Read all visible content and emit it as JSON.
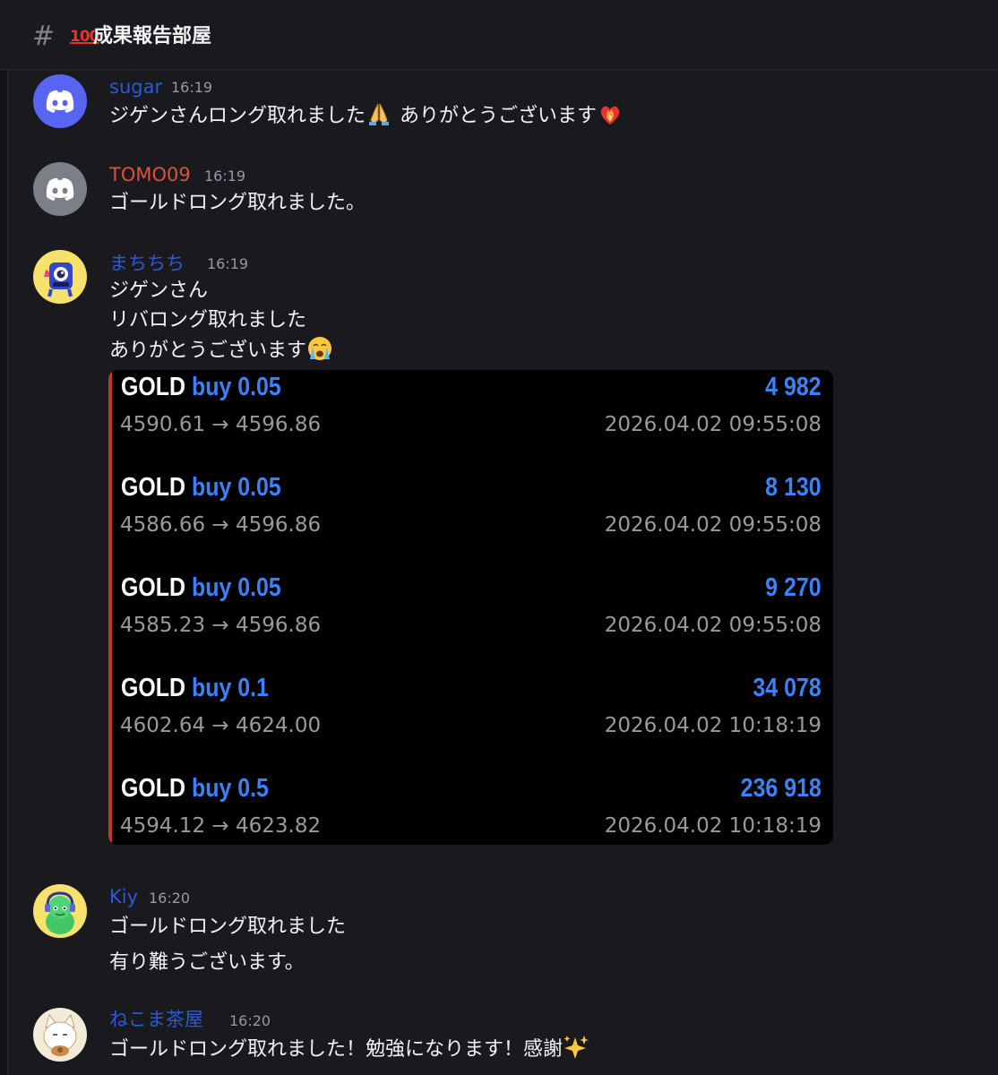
{
  "channel": {
    "hash": "#",
    "emoji": "100",
    "title": "成果報告部屋"
  },
  "messages": [
    {
      "username": "sugar",
      "username_color": "#2a5bd7",
      "time": "16:19",
      "avatar": "discord-logo-blurple",
      "lines": [
        "ジゲンさんロング取れました",
        "ありがとうございます"
      ],
      "emojis": [
        "folded-hands",
        "fire-heart"
      ]
    },
    {
      "username": "TOMO09",
      "username_color": "#e0503e",
      "time": "16:19",
      "avatar": "discord-logo-grey",
      "lines": [
        "ゴールドロング取れました。"
      ]
    },
    {
      "username": "まちちち",
      "username_color": "#2a5bd7",
      "time": "16:19",
      "avatar": "blue-monster-on-yellow",
      "lines": [
        "ジゲンさん",
        "リバロング取れました",
        "ありがとうございます"
      ],
      "emojis": [
        "loudly-crying-face"
      ]
    },
    {
      "username": "Kiy",
      "username_color": "#2a5bd7",
      "time": "16:20",
      "avatar": "green-character-on-yellow",
      "lines": [
        "ゴールドロング取れました",
        "有り難うございます。"
      ]
    },
    {
      "username": "ねこま茶屋",
      "username_color": "#2a5bd7",
      "time": "16:20",
      "avatar": "white-cat",
      "lines": [
        "ゴールドロング取れました！勉強になります！感謝"
      ],
      "emojis": [
        "sparkles"
      ]
    }
  ],
  "trades": [
    {
      "symbol": "GOLD",
      "side": "buy 0.05",
      "profit": "4 982",
      "prices": "4590.61 → 4596.86",
      "datetime": "2026.04.02 09:55:08"
    },
    {
      "symbol": "GOLD",
      "side": "buy 0.05",
      "profit": "8 130",
      "prices": "4586.66 → 4596.86",
      "datetime": "2026.04.02 09:55:08"
    },
    {
      "symbol": "GOLD",
      "side": "buy 0.05",
      "profit": "9 270",
      "prices": "4585.23 → 4596.86",
      "datetime": "2026.04.02 09:55:08"
    },
    {
      "symbol": "GOLD",
      "side": "buy 0.1",
      "profit": "34 078",
      "prices": "4602.64 → 4624.00",
      "datetime": "2026.04.02 10:18:19"
    },
    {
      "symbol": "GOLD",
      "side": "buy 0.5",
      "profit": "236 918",
      "prices": "4594.12 → 4623.82",
      "datetime": "2026.04.02 10:18:19"
    }
  ],
  "colors": {
    "background": "#1a1a1e",
    "link_blue": "#2a5bd7",
    "profit_blue": "#3b82f6",
    "accent_red": "#c0392b"
  }
}
